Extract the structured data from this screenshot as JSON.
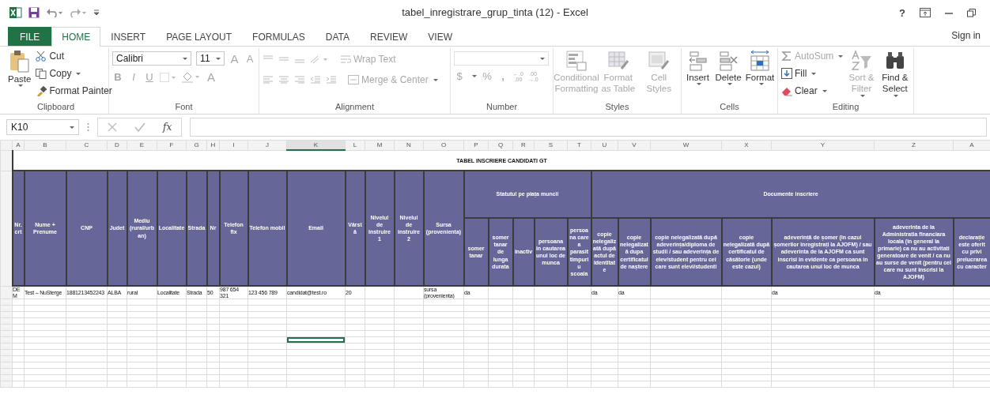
{
  "window": {
    "title": "tabel_inregistrare_grup_tinta (12) - Excel",
    "help": "?",
    "sign_in": "Sign in"
  },
  "tabs": [
    {
      "label": "FILE",
      "kind": "file",
      "selected": false
    },
    {
      "label": "HOME",
      "kind": "tab",
      "selected": true
    },
    {
      "label": "INSERT",
      "kind": "tab",
      "selected": false
    },
    {
      "label": "PAGE LAYOUT",
      "kind": "tab",
      "selected": false
    },
    {
      "label": "FORMULAS",
      "kind": "tab",
      "selected": false
    },
    {
      "label": "DATA",
      "kind": "tab",
      "selected": false
    },
    {
      "label": "REVIEW",
      "kind": "tab",
      "selected": false
    },
    {
      "label": "VIEW",
      "kind": "tab",
      "selected": false
    }
  ],
  "ribbon": {
    "clipboard": {
      "label": "Clipboard",
      "paste": "Paste",
      "cut": "Cut",
      "copy": "Copy",
      "format_painter": "Format Painter"
    },
    "font": {
      "label": "Font",
      "font_name": "Calibri",
      "font_size": "11",
      "grow": "A",
      "shrink": "A",
      "bold": "B",
      "italic": "I",
      "underline": "U",
      "font_color": "A"
    },
    "alignment": {
      "label": "Alignment",
      "wrap_text": "Wrap Text",
      "merge_center": "Merge & Center"
    },
    "number": {
      "label": "Number",
      "currency": "$",
      "percent": "%",
      "comma": ",",
      "increase_decimal": {
        "top": "←.0",
        "bottom": ".00"
      },
      "decrease_decimal": {
        "top": ".00",
        "bottom": "→.0"
      }
    },
    "styles": {
      "label": "Styles",
      "buttons": [
        {
          "label": "Conditional Formatting",
          "kind": "conditional",
          "disabled": true
        },
        {
          "label": "Format as Table",
          "kind": "table",
          "disabled": true
        },
        {
          "label": "Cell Styles",
          "kind": "cellstyles",
          "disabled": true
        }
      ]
    },
    "cells": {
      "label": "Cells",
      "buttons": [
        {
          "label": "Insert",
          "kind": "insert",
          "disabled": false
        },
        {
          "label": "Delete",
          "kind": "delete",
          "disabled": false
        },
        {
          "label": "Format",
          "kind": "format",
          "disabled": false
        }
      ]
    },
    "editing": {
      "label": "Editing",
      "small": [
        {
          "label": "AutoSum",
          "kind": "autosum",
          "disabled": true
        },
        {
          "label": "Fill",
          "kind": "fill",
          "disabled": false
        },
        {
          "label": "Clear",
          "kind": "clear",
          "disabled": false
        }
      ],
      "large": [
        {
          "label": "Sort & Filter",
          "kind": "sort",
          "disabled": true
        },
        {
          "label": "Find & Select",
          "kind": "find",
          "disabled": false
        }
      ]
    }
  },
  "formula_bar": {
    "name_box": "K10",
    "function": "fx"
  },
  "sheet": {
    "columns": [
      {
        "letter": "A",
        "selected": false
      },
      {
        "letter": "B",
        "selected": false
      },
      {
        "letter": "C",
        "selected": false
      },
      {
        "letter": "D",
        "selected": false
      },
      {
        "letter": "E",
        "selected": false
      },
      {
        "letter": "F",
        "selected": false
      },
      {
        "letter": "G",
        "selected": false
      },
      {
        "letter": "H",
        "selected": false
      },
      {
        "letter": "I",
        "selected": false
      },
      {
        "letter": "J",
        "selected": false
      },
      {
        "letter": "K",
        "selected": true
      },
      {
        "letter": "L",
        "selected": false
      },
      {
        "letter": "M",
        "selected": false
      },
      {
        "letter": "N",
        "selected": false
      },
      {
        "letter": "O",
        "selected": false
      },
      {
        "letter": "P",
        "selected": false
      },
      {
        "letter": "Q",
        "selected": false
      },
      {
        "letter": "R",
        "selected": false
      },
      {
        "letter": "S",
        "selected": false
      },
      {
        "letter": "T",
        "selected": false
      },
      {
        "letter": "U",
        "selected": false
      },
      {
        "letter": "V",
        "selected": false
      },
      {
        "letter": "W",
        "selected": false
      },
      {
        "letter": "X",
        "selected": false
      },
      {
        "letter": "Y",
        "selected": false
      },
      {
        "letter": "Z",
        "selected": false
      },
      {
        "letter": "A",
        "selected": false
      }
    ],
    "title": "TABEL INSCRIERE CANDIDATI GT",
    "headers": [
      "Nr. crt",
      "Nume + Prenume",
      "CNP",
      "Judet",
      "Mediu (rural/urban)",
      "Localitate",
      "Strada",
      "Nr",
      "Telefon fix",
      "Telefon mobil",
      "Email",
      "Vârstă",
      "Nivelul de instruire 1",
      "Nivelul de instruire 2",
      "Sursa (provenienta)"
    ],
    "groups": [
      {
        "label": "Statutul pe piața muncii",
        "children": [
          "somer tanar",
          "somer tanar de lunga durata",
          "inactiv",
          "persoana in cautarea unui loc de munca",
          "persoana care a parasit timpuriu scoala"
        ]
      },
      {
        "label": "Documente inscriere",
        "children": [
          "copie nelegalizată după actul de identitate",
          "copie nelegalizată dupa certificatul de naștere",
          "copie nelegalizată după adeverința/diploma de studii / sau adeverința de elev/student pentru cei care sunt elevi/studenti",
          "copie nelegalizată după certificatul de căsătorie (unde este cazul)",
          "adeverință de șomer (în cazul șomerilor înregistrați la AJOFM) / sau adeverinta de la AJOFM ca sunt inscrisi in evidente ca persoana in cautarea unui loc de munca",
          "adeverinta de la Administratia financiara locala (in general la primarie) ca nu au activitati generatoare de venit / ca nu au surse de venit (pentru cei care nu sunt inscrisi la AJOFM)",
          "declarație este oferit cu privi prelucrarea cu caracter"
        ]
      }
    ],
    "rows": [
      {
        "cells": {
          "A": "DEM",
          "B": "Test – NuSterge",
          "C": "1881213452243",
          "D": "ALBA",
          "E": "rural",
          "F": "Localitate",
          "G": "Strada",
          "H": "50",
          "I": "987 654 321",
          "J": "123 456 789",
          "K": "candidat@test.ro",
          "L": "20",
          "O": "sursa (provenienta)",
          "P": "da",
          "U": "da",
          "V": "da",
          "Y": "da",
          "Z": "da"
        }
      }
    ],
    "blank_rows": [
      {
        "selected": false
      },
      {
        "selected": false
      },
      {
        "selected": false
      },
      {
        "selected": false
      },
      {
        "selected": false
      },
      {
        "selected": false
      },
      {
        "selected": true
      },
      {
        "selected": false
      },
      {
        "selected": false
      },
      {
        "selected": false
      },
      {
        "selected": false
      },
      {
        "selected": false
      },
      {
        "selected": false
      },
      {
        "selected": false
      }
    ]
  }
}
